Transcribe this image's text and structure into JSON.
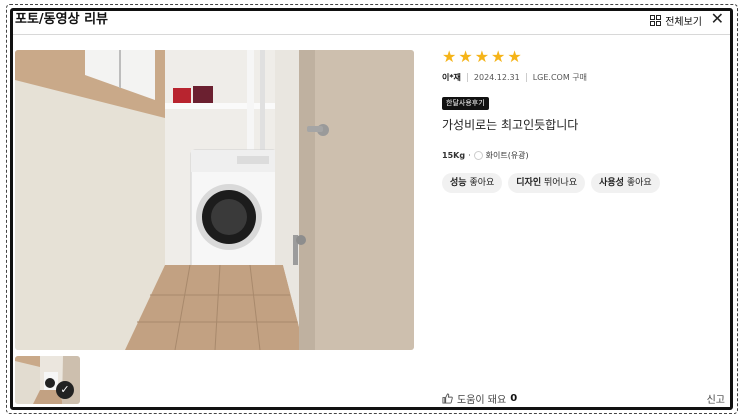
{
  "header": {
    "title": "포토/동영상 리뷰",
    "view_all": "전체보기",
    "close_icon": "close-icon",
    "grid_icon": "grid-icon"
  },
  "review": {
    "rating": 5,
    "author": "이*재",
    "date": "2024.12.31",
    "source": "LGE.COM 구매",
    "badge": "한달사용후기",
    "text": "가성비로는 최고인듯합니다",
    "option_capacity": "15Kg",
    "option_color": "화이트(유광)",
    "tags": [
      {
        "label": "성능",
        "value": "좋아요"
      },
      {
        "label": "디자인",
        "value": "뛰어나요"
      },
      {
        "label": "사용성",
        "value": "좋아요"
      }
    ]
  },
  "footer": {
    "helpful_label": "도움이 돼요",
    "helpful_count": "0",
    "report": "신고"
  },
  "colors": {
    "star": "#f5b419",
    "badge_bg": "#111111",
    "chip_bg": "#f1f1f1"
  }
}
